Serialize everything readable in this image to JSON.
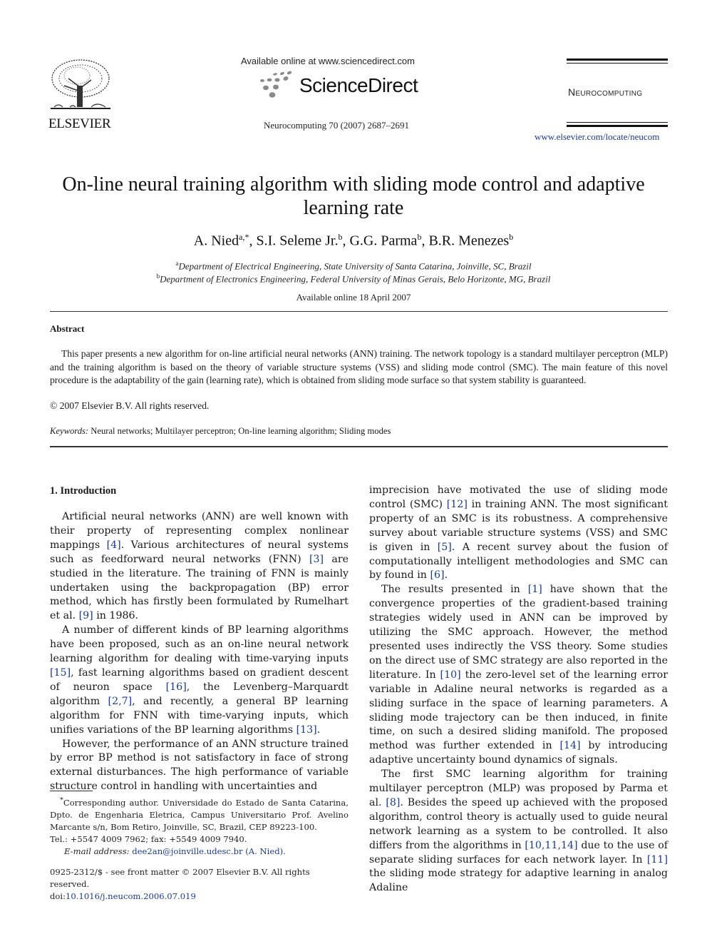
{
  "header": {
    "publisher": "ELSEVIER",
    "available_online_at": "Available online at www.sciencedirect.com",
    "platform": "ScienceDirect",
    "journal_citation": "Neurocomputing 70 (2007) 2687–2691",
    "journal_name": "Neurocomputing",
    "journal_url": "www.elsevier.com/locate/neucom"
  },
  "article": {
    "title": "On-line neural training algorithm with sliding mode control and adaptive learning rate",
    "authors": [
      {
        "name": "A. Nied",
        "sup": "a,*"
      },
      {
        "name": "S.I. Seleme Jr.",
        "sup": "b"
      },
      {
        "name": "G.G. Parma",
        "sup": "b"
      },
      {
        "name": "B.R. Menezes",
        "sup": "b"
      }
    ],
    "affiliations": [
      {
        "mark": "a",
        "text": "Department of Electrical Engineering, State University of Santa Catarina, Joinville, SC, Brazil"
      },
      {
        "mark": "b",
        "text": "Department of Electronics Engineering, Federal University of Minas Gerais, Belo Horizonte, MG, Brazil"
      }
    ],
    "available_online": "Available online 18 April 2007"
  },
  "abstract": {
    "heading": "Abstract",
    "text": "This paper presents a new algorithm for on-line artificial neural networks (ANN) training. The network topology is a standard multilayer perceptron (MLP) and the training algorithm is based on the theory of variable structure systems (VSS) and sliding mode control (SMC). The main feature of this novel procedure is the adaptability of the gain (learning rate), which is obtained from sliding mode surface so that system stability is guaranteed.",
    "copyright": "© 2007 Elsevier B.V. All rights reserved.",
    "keywords_label": "Keywords:",
    "keywords": "Neural networks; Multilayer perceptron; On-line learning algorithm; Sliding modes"
  },
  "introduction": {
    "heading": "1.  Introduction",
    "left_paragraphs": [
      [
        {
          "t": "Artificial neural networks (ANN) are well known with their property of representing complex nonlinear mappings "
        },
        {
          "r": "[4]"
        },
        {
          "t": ". Various architectures of neural systems such as feedforward neural networks (FNN) "
        },
        {
          "r": "[3]"
        },
        {
          "t": " are studied in the literature. The training of FNN is mainly undertaken using the backpropagation (BP) error method, which has firstly been formulated by Rumelhart et al. "
        },
        {
          "r": "[9]"
        },
        {
          "t": " in 1986."
        }
      ],
      [
        {
          "t": "A number of different kinds of BP learning algorithms have been proposed, such as an on-line neural network learning algorithm for dealing with time-varying inputs "
        },
        {
          "r": "[15]"
        },
        {
          "t": ", fast learning algorithms based on gradient descent of neuron space "
        },
        {
          "r": "[16]"
        },
        {
          "t": ", the Levenberg–Marquardt algorithm "
        },
        {
          "r": "[2,7]"
        },
        {
          "t": ", and recently, a general BP learning algorithm for FNN with time-varying inputs, which unifies variations of the BP learning algorithms "
        },
        {
          "r": "[13]"
        },
        {
          "t": "."
        }
      ],
      [
        {
          "t": "However, the performance of an ANN structure trained by error BP method is not satisfactory in face of strong external disturbances. The high performance of variable structure control in handling with uncertainties and"
        }
      ]
    ],
    "right_paragraphs": [
      {
        "indent": false,
        "runs": [
          {
            "t": "imprecision have motivated the use of sliding mode control (SMC) "
          },
          {
            "r": "[12]"
          },
          {
            "t": " in training ANN. The most significant property of an SMC is its robustness. A comprehensive survey about variable structure systems (VSS) and SMC is given in "
          },
          {
            "r": "[5]"
          },
          {
            "t": ". A recent survey about the fusion of computationally intelligent methodologies and SMC can by found in "
          },
          {
            "r": "[6]"
          },
          {
            "t": "."
          }
        ]
      },
      {
        "indent": true,
        "runs": [
          {
            "t": "The results presented in "
          },
          {
            "r": "[1]"
          },
          {
            "t": " have shown that the convergence properties of the gradient-based training strategies widely used in ANN can be improved by utilizing the SMC approach. However, the method presented uses indirectly the VSS theory. Some studies on the direct use of SMC strategy are also reported in the literature. In "
          },
          {
            "r": "[10]"
          },
          {
            "t": " the zero-level set of the learning error variable in Adaline neural networks is regarded as a sliding surface in the space of learning parameters. A sliding mode trajectory can be then induced, in finite time, on such a desired sliding manifold. The proposed method was further extended in "
          },
          {
            "r": "[14]"
          },
          {
            "t": " by introducing adaptive uncertainty bound dynamics of signals."
          }
        ]
      },
      {
        "indent": true,
        "runs": [
          {
            "t": "The first SMC learning algorithm for training multilayer perceptron (MLP) was proposed by Parma et al. "
          },
          {
            "r": "[8]"
          },
          {
            "t": ". Besides the speed up achieved with the proposed algorithm, control theory is actually used to guide neural network learning as a system to be controlled. It also differs from the algorithms in "
          },
          {
            "r": "[10,11,14]"
          },
          {
            "t": " due to the use of separate sliding surfaces for each network layer. In "
          },
          {
            "r": "[11]"
          },
          {
            "t": " the sliding mode strategy for adaptive learning in analog Adaline"
          }
        ]
      }
    ]
  },
  "footnote": {
    "marker": "*",
    "corresponding": "Corresponding author. Universidade do Estado de Santa Catarina, Dpto. de Engenharia Eletrica, Campus Universitario Prof. Avelino Marcante s/n, Bom Retiro, Joinville, SC, Brazil, CEP 89223-100.",
    "phone": "Tel.: +5547 4009 7962; fax: +5549 4009 7940.",
    "email_label": "E-mail address:",
    "email": "dee2an@joinville.udesc.br (A. Nied)."
  },
  "front_matter": {
    "issn_line": "0925-2312/$ - see front matter © 2007 Elsevier B.V. All rights reserved.",
    "doi_label": "doi:",
    "doi": "10.1016/j.neucom.2006.07.019"
  },
  "colors": {
    "link": "#1a3a8a",
    "text": "#1a1a1a"
  }
}
